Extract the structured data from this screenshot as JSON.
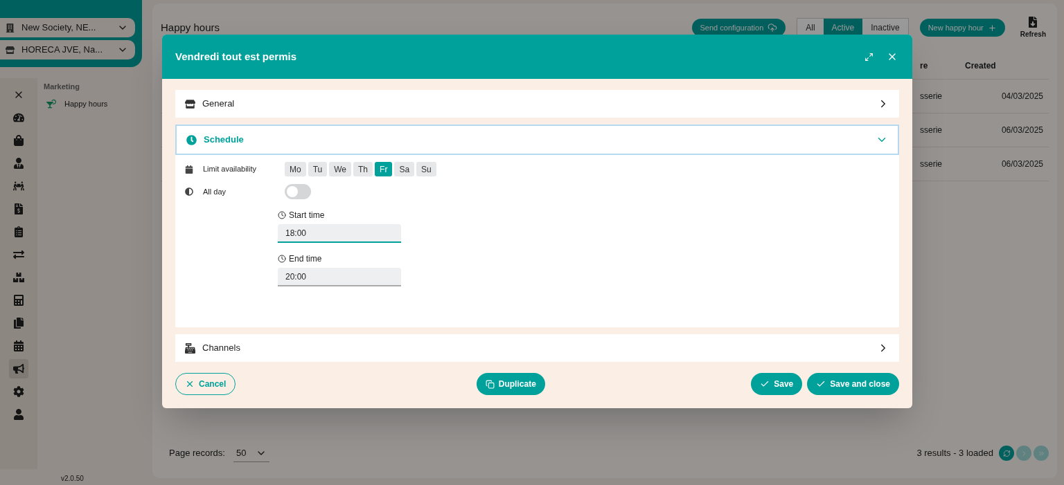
{
  "sidebar": {
    "company_selectors": [
      {
        "kind": "company",
        "label": "New Society, NE..."
      },
      {
        "kind": "store",
        "label": "HORECA JVE, Na..."
      }
    ],
    "nav_icons": [
      {
        "kind": "close",
        "selected": false
      },
      {
        "kind": "dashboard",
        "selected": false
      },
      {
        "kind": "sales",
        "selected": false
      },
      {
        "kind": "staff",
        "selected": false
      },
      {
        "kind": "delivery",
        "selected": false
      },
      {
        "kind": "invoice",
        "selected": false
      },
      {
        "kind": "clipboard",
        "selected": false
      },
      {
        "kind": "transfer",
        "selected": false
      },
      {
        "kind": "stock",
        "selected": false
      },
      {
        "kind": "calculator",
        "selected": false
      },
      {
        "kind": "devices",
        "selected": false
      },
      {
        "kind": "calendar",
        "selected": false
      },
      {
        "kind": "marketing",
        "selected": true
      },
      {
        "kind": "settings",
        "selected": false
      },
      {
        "kind": "user",
        "selected": false
      }
    ],
    "section_title": "Marketing",
    "menu_items": [
      {
        "label": "Happy hours"
      }
    ],
    "version": "v2.0.50"
  },
  "page": {
    "title": "Happy hours",
    "send_button": "Send configuration",
    "filters": [
      {
        "label": "All",
        "selected": false
      },
      {
        "label": "Active",
        "selected": true
      },
      {
        "label": "Inactive",
        "selected": false
      }
    ],
    "new_button": "New happy hour",
    "refresh_button": "Refresh",
    "table": {
      "columns": [
        "re",
        "Created"
      ],
      "rows": [
        {
          "column_1": "sserie",
          "created": "04/03/2025"
        },
        {
          "column_1": "sserie",
          "created": "06/03/2025"
        },
        {
          "column_1": "sserie",
          "created": "06/03/2025"
        }
      ]
    },
    "footer": {
      "page_records_label": "Page records:",
      "page_records_value": "50",
      "results": "3 results - 3 loaded"
    }
  },
  "dialog": {
    "title": "Vendredi tout est permis",
    "sections": [
      {
        "kind": "general",
        "label": "General",
        "expanded": false
      },
      {
        "kind": "schedule",
        "label": "Schedule",
        "expanded": true
      },
      {
        "kind": "channels",
        "label": "Channels",
        "expanded": false
      }
    ],
    "schedule": {
      "limit_label": "Limit availability",
      "days": [
        {
          "label": "Mo",
          "selected": false
        },
        {
          "label": "Tu",
          "selected": false
        },
        {
          "label": "We",
          "selected": false
        },
        {
          "label": "Th",
          "selected": false
        },
        {
          "label": "Fr",
          "selected": true
        },
        {
          "label": "Sa",
          "selected": false
        },
        {
          "label": "Su",
          "selected": false
        }
      ],
      "all_day_label": "All day",
      "all_day_on": false,
      "start_label": "Start time",
      "start_value": "18:00",
      "end_label": "End time",
      "end_value": "20:00"
    },
    "buttons": {
      "cancel": "Cancel",
      "duplicate": "Duplicate",
      "save": "Save",
      "save_close": "Save and close"
    }
  }
}
